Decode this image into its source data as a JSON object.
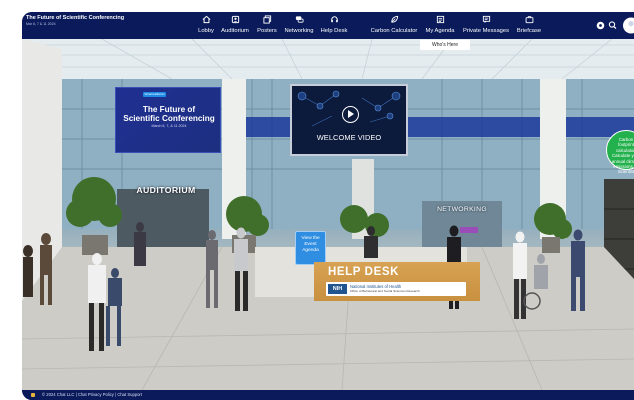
{
  "header": {
    "logo_title": "The Future of Scientific Conferencing",
    "logo_subtitle": "Mar 6, 7 & 11 2024"
  },
  "nav": {
    "items": [
      {
        "label": "Lobby",
        "icon": "home-icon"
      },
      {
        "label": "Auditorium",
        "icon": "auditorium-icon"
      },
      {
        "label": "Posters",
        "icon": "posters-icon"
      },
      {
        "label": "Networking",
        "icon": "chat-icon"
      },
      {
        "label": "Help Desk",
        "icon": "headset-icon"
      },
      {
        "label": "Carbon Calculator",
        "icon": "leaf-icon"
      },
      {
        "label": "My Agenda",
        "icon": "agenda-icon"
      },
      {
        "label": "Private Messages",
        "icon": "message-icon"
      },
      {
        "label": "Briefcase",
        "icon": "briefcase-icon"
      }
    ],
    "right_icons": [
      "settings-icon",
      "search-icon",
      "avatar"
    ]
  },
  "lobby": {
    "whos_here": "Who's Here",
    "auditorium_sign_chip": "Virtual Auditorium",
    "auditorium_title_line1": "The Future of",
    "auditorium_title_line2": "Scientific Conferencing",
    "auditorium_dates": "March 6, 7, & 11 2024",
    "auditorium_label": "AUDITORIUM",
    "video_label": "WELCOME VIDEO",
    "networking_label": "NETWORKING",
    "agenda_button": "View the Event Agenda",
    "help_desk_title": "HELP DESK",
    "nih_mark": "NIH",
    "nih_name": "National Institutes of Health",
    "nih_sub": "Office of Behavioral and Social Sciences Research",
    "green_badge": "Carbon footprint calculator: Calculate your annual climate emissions as Scientist"
  },
  "footer": {
    "text": "© 2024 Chat LLC | Chat Privacy Policy | Chat Support"
  },
  "colors": {
    "nav_bg": "#0a1a5a",
    "accent_blue": "#2f8ee2",
    "help_desk_gold": "#d7a253",
    "badge_green": "#23b14d"
  }
}
